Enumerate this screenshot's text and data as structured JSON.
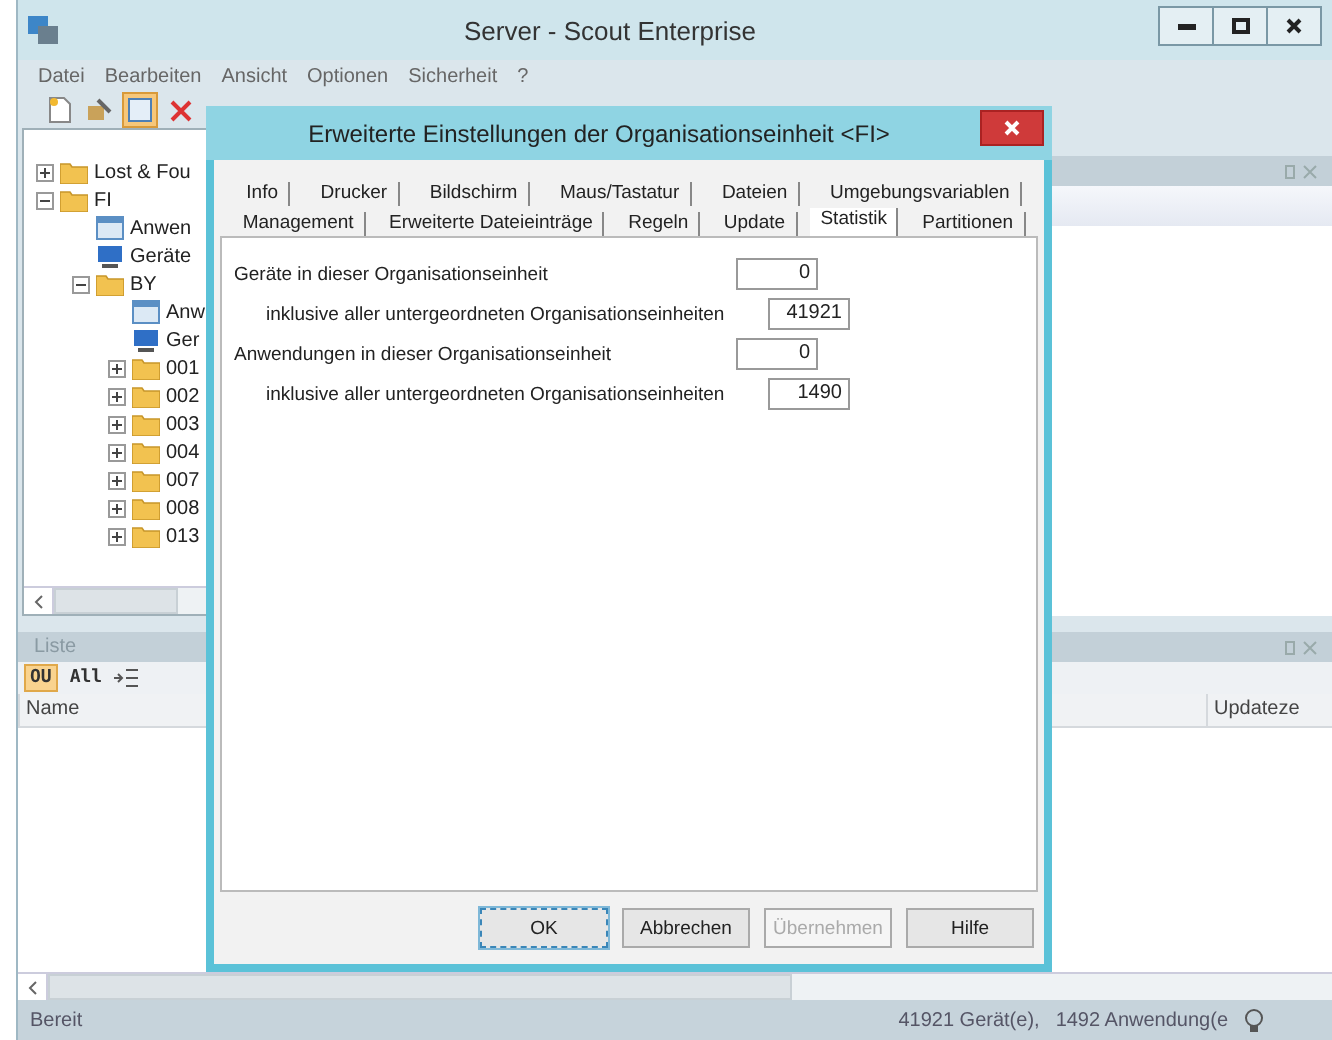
{
  "window": {
    "title": "Server - Scout Enterprise"
  },
  "menu": [
    "Datei",
    "Bearbeiten",
    "Ansicht",
    "Optionen",
    "Sicherheit",
    "?"
  ],
  "toolbar": [
    {
      "kind": "new",
      "selected": false
    },
    {
      "kind": "tool",
      "selected": false
    },
    {
      "kind": "window",
      "selected": true
    },
    {
      "kind": "delete",
      "selected": false
    }
  ],
  "tree": [
    {
      "label": "Lost & Fou",
      "kind": "folder",
      "expanded": false
    },
    {
      "label": "FI",
      "kind": "folder",
      "expanded": true,
      "children": [
        {
          "label": "Anwen",
          "kind": "apps"
        },
        {
          "label": "Geräte",
          "kind": "devices"
        },
        {
          "label": "BY",
          "kind": "folder",
          "expanded": true,
          "children": [
            {
              "label": "Anw",
              "kind": "apps"
            },
            {
              "label": "Ger",
              "kind": "devices"
            },
            {
              "label": "001",
              "kind": "folder",
              "expanded": false
            },
            {
              "label": "002",
              "kind": "folder",
              "expanded": false
            },
            {
              "label": "003",
              "kind": "folder",
              "expanded": false
            },
            {
              "label": "004",
              "kind": "folder",
              "expanded": false
            },
            {
              "label": "007",
              "kind": "folder",
              "expanded": false
            },
            {
              "label": "008",
              "kind": "folder",
              "expanded": false
            },
            {
              "label": "013",
              "kind": "folder",
              "expanded": false
            }
          ]
        }
      ]
    }
  ],
  "dialog": {
    "title": "Erweiterte Einstellungen der Organisationseinheit <FI>",
    "tab_rows": [
      [
        {
          "label": "Info",
          "selected": false
        },
        {
          "label": "Drucker",
          "selected": false
        },
        {
          "label": "Bildschirm",
          "selected": false
        },
        {
          "label": "Maus/Tastatur",
          "selected": false
        },
        {
          "label": "Dateien",
          "selected": false
        },
        {
          "label": "Umgebungsvariablen",
          "selected": false
        }
      ],
      [
        {
          "label": "Management",
          "selected": false
        },
        {
          "label": "Erweiterte Dateieinträge",
          "selected": false
        },
        {
          "label": "Regeln",
          "selected": false
        },
        {
          "label": "Update",
          "selected": false
        },
        {
          "label": "Statistik",
          "selected": true
        },
        {
          "label": "Partitionen",
          "selected": false
        }
      ]
    ],
    "stats": [
      {
        "kind": "main",
        "label": "Geräte in dieser Organisationseinheit",
        "value": "0"
      },
      {
        "kind": "sub",
        "label": "inklusive aller untergeordneten Organisationseinheiten",
        "value": "41921"
      },
      {
        "kind": "main",
        "label": "Anwendungen in dieser Organisationseinheit",
        "value": "0"
      },
      {
        "kind": "sub",
        "label": "inklusive aller untergeordneten Organisationseinheiten",
        "value": "1490"
      }
    ],
    "buttons": [
      {
        "label": "OK",
        "default": true,
        "disabled": false
      },
      {
        "label": "Abbrechen",
        "default": false,
        "disabled": false
      },
      {
        "label": "Übernehmen",
        "default": false,
        "disabled": true
      },
      {
        "label": "Hilfe",
        "default": false,
        "disabled": false
      }
    ]
  },
  "list_pane": {
    "title": "Liste",
    "filters": [
      {
        "label": "OU",
        "selected": true
      },
      {
        "label": "All",
        "selected": false
      }
    ],
    "columns": [
      "Name",
      "Updateze"
    ]
  },
  "status_bar": {
    "text": "Bereit",
    "devices": "41921 Gerät(e),",
    "apps": "1492 Anwendung(e"
  }
}
